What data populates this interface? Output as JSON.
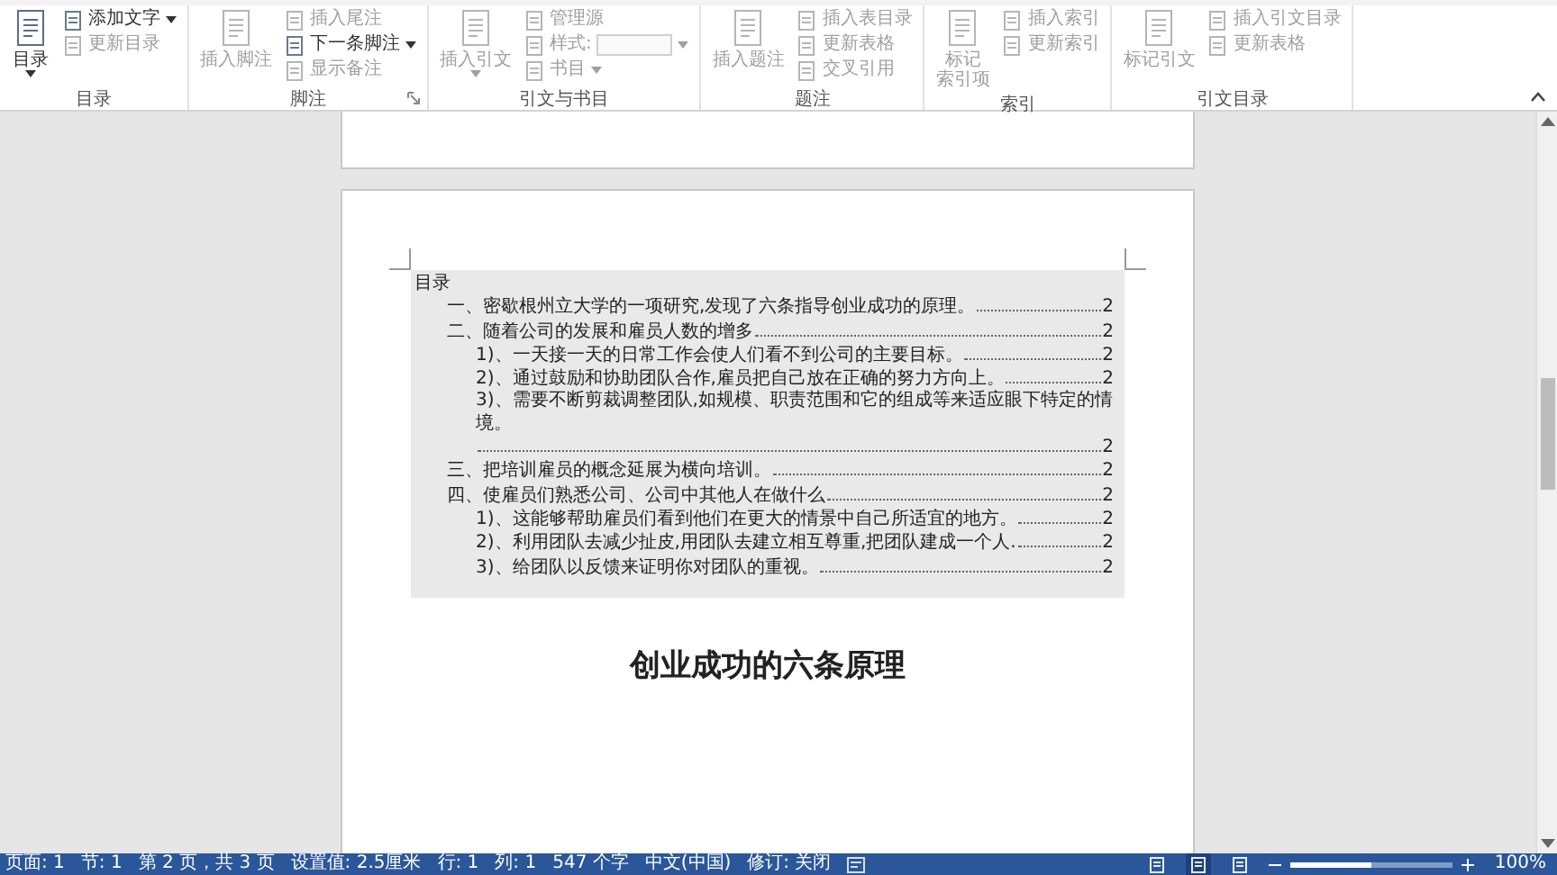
{
  "ribbon": {
    "groups": [
      {
        "label": "目录",
        "dialog_launcher": false,
        "big_button": {
          "label_lines": [
            "目录"
          ],
          "caret": true,
          "disabled": false
        },
        "small_buttons": [
          {
            "kind": "button",
            "label": "添加文字",
            "caret": true,
            "disabled": false
          },
          {
            "kind": "button",
            "label": "更新目录",
            "caret": false,
            "disabled": true
          }
        ]
      },
      {
        "label": "脚注",
        "dialog_launcher": true,
        "big_button": {
          "label_lines": [
            "插入脚注"
          ],
          "caret": false,
          "disabled": true
        },
        "small_buttons": [
          {
            "kind": "button",
            "label": "插入尾注",
            "caret": false,
            "disabled": true
          },
          {
            "kind": "button",
            "label": "下一条脚注",
            "caret": true,
            "disabled": false
          },
          {
            "kind": "button",
            "label": "显示备注",
            "caret": false,
            "disabled": true
          }
        ]
      },
      {
        "label": "引文与书目",
        "dialog_launcher": false,
        "big_button": {
          "label_lines": [
            "插入引文"
          ],
          "caret": true,
          "disabled": true
        },
        "small_buttons": [
          {
            "kind": "button",
            "label": "管理源",
            "caret": false,
            "disabled": true
          },
          {
            "kind": "dropdown",
            "label": "样式:",
            "caret": true,
            "disabled": true
          },
          {
            "kind": "button",
            "label": "书目",
            "caret": true,
            "disabled": true
          }
        ]
      },
      {
        "label": "题注",
        "dialog_launcher": false,
        "big_button": {
          "label_lines": [
            "插入题注"
          ],
          "caret": false,
          "disabled": true
        },
        "small_buttons": [
          {
            "kind": "button",
            "label": "插入表目录",
            "caret": false,
            "disabled": true
          },
          {
            "kind": "button",
            "label": "更新表格",
            "caret": false,
            "disabled": true
          },
          {
            "kind": "button",
            "label": "交叉引用",
            "caret": false,
            "disabled": true
          }
        ]
      },
      {
        "label": "索引",
        "dialog_launcher": false,
        "big_button": {
          "label_lines": [
            "标记",
            "索引项"
          ],
          "caret": false,
          "disabled": true
        },
        "small_buttons": [
          {
            "kind": "button",
            "label": "插入索引",
            "caret": false,
            "disabled": true
          },
          {
            "kind": "button",
            "label": "更新索引",
            "caret": false,
            "disabled": true
          }
        ]
      },
      {
        "label": "引文目录",
        "dialog_launcher": false,
        "big_button": {
          "label_lines": [
            "标记引文"
          ],
          "caret": false,
          "disabled": true
        },
        "small_buttons": [
          {
            "kind": "button",
            "label": "插入引文目录",
            "caret": false,
            "disabled": true
          },
          {
            "kind": "button",
            "label": "更新表格",
            "caret": false,
            "disabled": true
          }
        ]
      }
    ]
  },
  "document": {
    "toc": {
      "heading": "目录",
      "entries": [
        {
          "text": "一、密歇根州立大学的一项研究,发现了六条指导创业成功的原理。",
          "page": "2"
        },
        {
          "text": "二、随着公司的发展和雇员人数的增多",
          "page": "2",
          "children": [
            {
              "text": "1)、一天接一天的日常工作会使人们看不到公司的主要目标。",
              "page": "2"
            },
            {
              "text": "2)、通过鼓励和协助团队合作,雇员把自己放在正确的努力方向上。",
              "page": "2"
            },
            {
              "text": "3)、需要不断剪裁调整团队,如规模、职责范围和它的组成等来适应眼下特定的情境。",
              "page": "2"
            }
          ]
        },
        {
          "text": "三、把培训雇员的概念延展为横向培训。",
          "page": "2"
        },
        {
          "text": "四、使雇员们熟悉公司、公司中其他人在做什么",
          "page": "2",
          "children": [
            {
              "text": "1)、这能够帮助雇员们看到他们在更大的情景中自己所适宜的地方。",
              "page": "2"
            },
            {
              "text": "2)、利用团队去减少扯皮,用团队去建立相互尊重,把团队建成一个人.",
              "page": "2"
            },
            {
              "text": "3)、给团队以反馈来证明你对团队的重视。",
              "page": "2"
            }
          ]
        }
      ]
    },
    "title": "创业成功的六条原理"
  },
  "status_bar": {
    "items": [
      "页面: 1",
      "节: 1",
      "第 2 页，共 3 页",
      "设置值: 2.5厘米",
      "行: 1",
      "列: 1",
      "547 个字",
      "中文(中国)",
      "修订: 关闭"
    ],
    "views": [
      {
        "selected": false
      },
      {
        "selected": true
      },
      {
        "selected": false
      }
    ],
    "zoom": {
      "level": 0.5,
      "reading": "100%"
    }
  }
}
